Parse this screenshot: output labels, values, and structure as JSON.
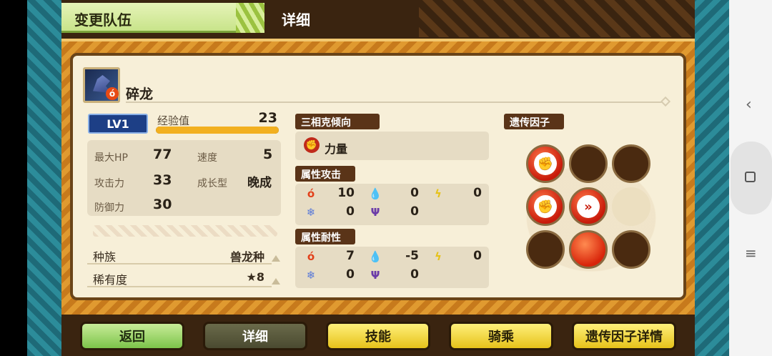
{
  "header": {
    "tab_change_team": "变更队伍",
    "tab_detail": "详细"
  },
  "monster": {
    "name": "碎龙",
    "level": "LV1",
    "exp_label": "经验值",
    "exp_value": "23",
    "exp_fraction": 1.0
  },
  "stats": {
    "max_hp_label": "最大HP",
    "max_hp": "77",
    "speed_label": "速度",
    "speed": "5",
    "attack_label": "攻击力",
    "attack": "33",
    "growth_label": "成长型",
    "growth": "晚成",
    "defense_label": "防御力",
    "defense": "30"
  },
  "info": {
    "species_label": "种族",
    "species": "兽龙种",
    "rarity_label": "稀有度",
    "rarity": "★8"
  },
  "affinity": {
    "title": "三相克倾向",
    "type": "力量"
  },
  "element_attack": {
    "title": "属性攻击",
    "fire": "10",
    "water": "0",
    "thunder": "0",
    "ice": "0",
    "dragon": "0"
  },
  "element_resist": {
    "title": "属性耐性",
    "fire": "7",
    "water": "-5",
    "thunder": "0",
    "ice": "0",
    "dragon": "0"
  },
  "genes": {
    "title": "遗传因子",
    "slots": [
      "power",
      "empty",
      "empty",
      "power",
      "speed",
      "faint",
      "empty",
      "red",
      "empty"
    ]
  },
  "buttons": {
    "back": "返回",
    "detail": "详细",
    "skills": "技能",
    "ride": "骑乘",
    "gene_detail": "遗传因子详情"
  },
  "colors": {
    "panel": "#f7efd8",
    "frame_orange": "#e09a30",
    "frame_teal": "#2c8c9a",
    "button_green": "#7cc44a",
    "button_yellow": "#e6c21a"
  }
}
